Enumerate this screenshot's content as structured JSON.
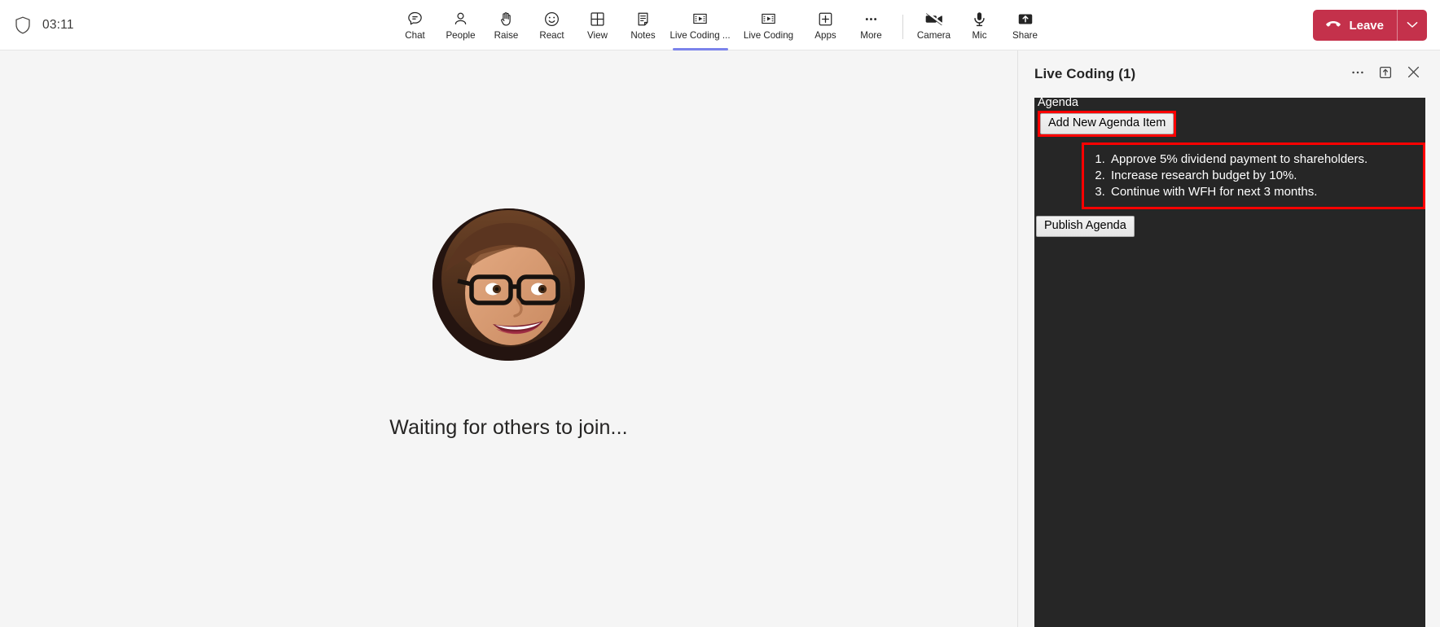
{
  "topbar": {
    "security_icon": "shield-icon",
    "call_timer": "03:11",
    "items": [
      {
        "label": "Chat",
        "icon": "chat-icon",
        "active": false
      },
      {
        "label": "People",
        "icon": "people-icon",
        "active": false
      },
      {
        "label": "Raise",
        "icon": "raise-hand-icon",
        "active": false
      },
      {
        "label": "React",
        "icon": "react-smiley-icon",
        "active": false
      },
      {
        "label": "View",
        "icon": "view-grid-icon",
        "active": false
      },
      {
        "label": "Notes",
        "icon": "notes-icon",
        "active": false
      },
      {
        "label": "Live Coding ...",
        "icon": "live-coding-icon",
        "active": true
      },
      {
        "label": "Live Coding",
        "icon": "live-coding-icon",
        "active": false
      },
      {
        "label": "Apps",
        "icon": "apps-plus-icon",
        "active": false
      },
      {
        "label": "More",
        "icon": "more-ellipsis-icon",
        "active": false
      }
    ],
    "device_items": [
      {
        "label": "Camera",
        "icon": "camera-off-icon"
      },
      {
        "label": "Mic",
        "icon": "mic-icon"
      },
      {
        "label": "Share",
        "icon": "share-screen-icon"
      }
    ],
    "leave": {
      "label": "Leave",
      "icon": "hangup-icon",
      "caret_icon": "chevron-down-icon",
      "color": "#c4314b"
    }
  },
  "stage": {
    "avatar_name": "participant-avatar",
    "waiting_text": "Waiting for others to join..."
  },
  "panel": {
    "title": "Live Coding (1)",
    "actions": [
      {
        "name": "more-options-icon",
        "icon": "more-ellipsis-icon"
      },
      {
        "name": "pop-out-icon",
        "icon": "pop-out-icon"
      },
      {
        "name": "close-icon",
        "icon": "close-x-icon"
      }
    ],
    "app": {
      "heading": "Agenda",
      "add_button": "Add New Agenda Item",
      "publish_button": "Publish Agenda",
      "items": [
        "Approve 5% dividend payment to shareholders.",
        "Increase research budget by 10%.",
        "Continue with WFH for next 3 months."
      ],
      "highlight_color": "#ff0000",
      "background": "#262626"
    }
  }
}
